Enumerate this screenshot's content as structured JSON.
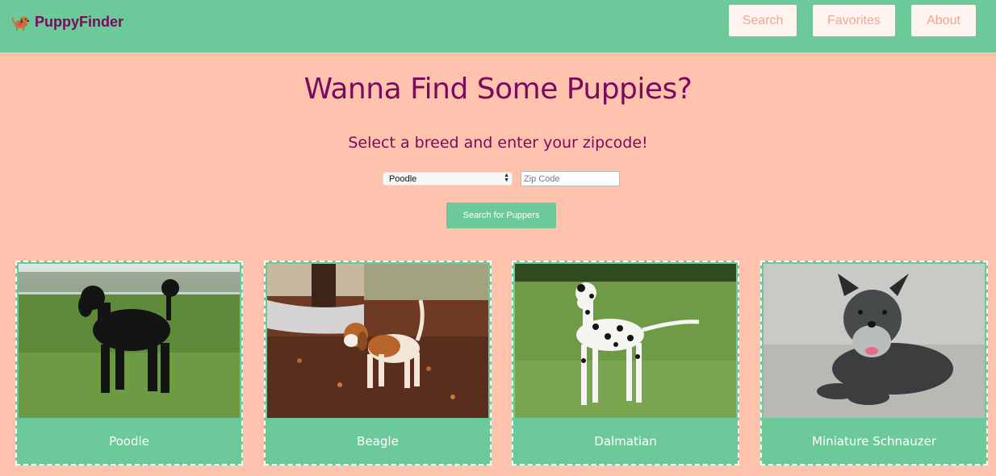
{
  "app": {
    "brand": "PuppyFinder",
    "logo_icon": "puppy-logo-icon"
  },
  "nav": {
    "search_label": "Search",
    "favorites_label": "Favorites",
    "about_label": "About"
  },
  "hero": {
    "title": "Wanna Find Some Puppies?",
    "subtitle": "Select a breed and enter your zipcode!"
  },
  "form": {
    "breed_selected": "Poodle",
    "zip_placeholder": "Zip Code",
    "zip_value": "",
    "submit_label": "Search for Puppers"
  },
  "breeds": [
    {
      "label": "Poodle",
      "photo_icon": "poodle-photo"
    },
    {
      "label": "Beagle",
      "photo_icon": "beagle-photo"
    },
    {
      "label": "Dalmatian",
      "photo_icon": "dalmatian-photo"
    },
    {
      "label": "Miniature Schnauzer",
      "photo_icon": "schnauzer-photo"
    }
  ],
  "colors": {
    "navbar_bg": "#6cc99a",
    "page_bg": "#ffc2ac",
    "accent_text": "#7a0a5e",
    "nav_button_text": "#f7a38d",
    "card_label_bg": "#6cc99a"
  }
}
